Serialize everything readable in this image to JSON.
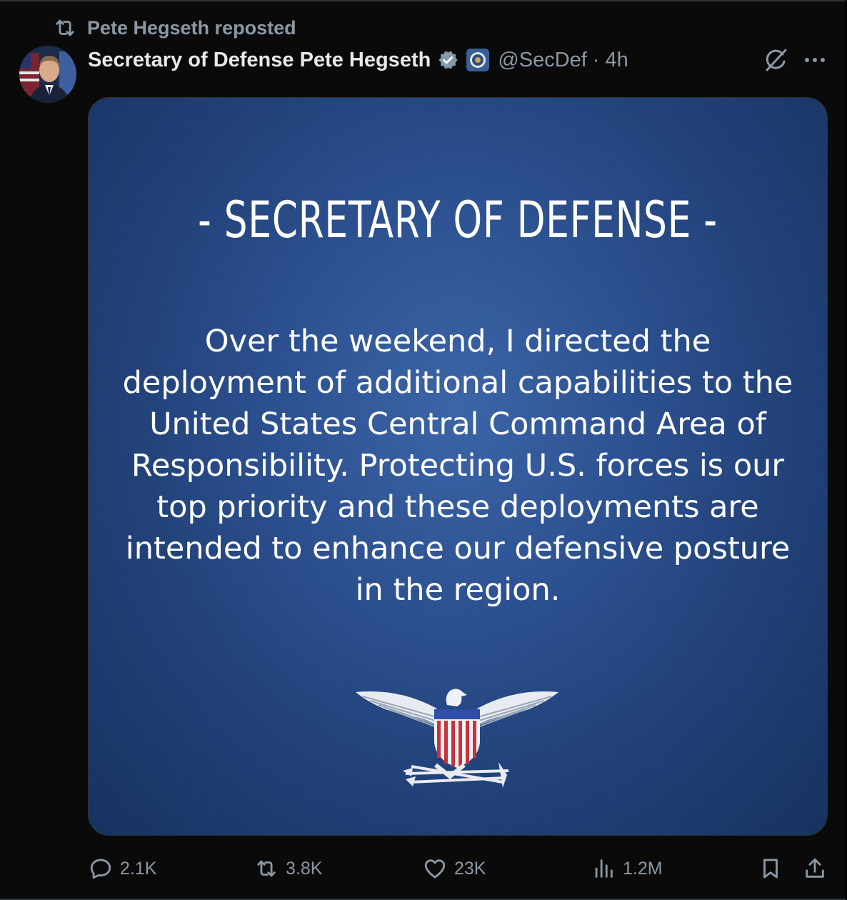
{
  "repost": {
    "text": "Pete Hegseth reposted",
    "icon": "repost-icon"
  },
  "post": {
    "author_name": "Secretary of Defense Pete Hegseth",
    "handle": "@SecDef",
    "separator": "·",
    "time": "4h",
    "verified_color": "#829aab"
  },
  "media": {
    "title": "- SECRETARY OF DEFENSE -",
    "body_lines": [
      "Over the weekend, I directed the",
      "deployment of additional capabilities to the",
      "United States Central Command Area of",
      "Responsibility. Protecting U.S. forces is our",
      "top priority and these deployments are",
      "intended to enhance our defensive posture",
      "in the region."
    ],
    "background_color": "#2b5193",
    "emblem": "eagle-insignia"
  },
  "actions": {
    "replies": "2.1K",
    "reposts": "3.8K",
    "likes": "23K",
    "views": "1.2M"
  }
}
